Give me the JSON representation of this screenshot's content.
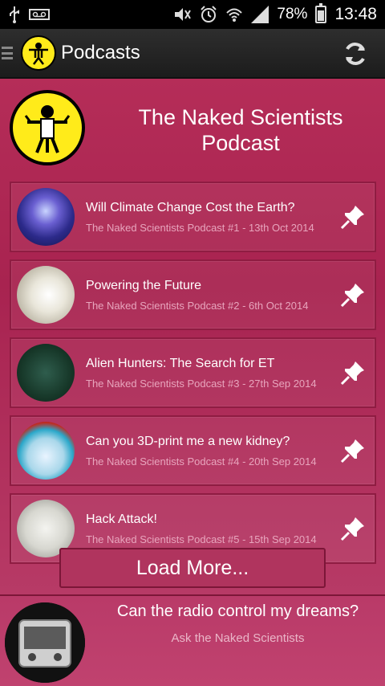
{
  "status_bar": {
    "battery": "78%",
    "time": "13:48"
  },
  "app_bar": {
    "title": "Podcasts"
  },
  "podcast": {
    "title": "The Naked Scientists Podcast"
  },
  "episodes": [
    {
      "title": "Will Climate Change Cost the Earth?",
      "meta": "The Naked Scientists Podcast #1  -  13th Oct 2014"
    },
    {
      "title": "Powering the Future",
      "meta": "The Naked Scientists Podcast #2  -  6th Oct 2014"
    },
    {
      "title": "Alien Hunters: The Search for ET",
      "meta": "The Naked Scientists Podcast #3  -  27th Sep 2014"
    },
    {
      "title": "Can you 3D-print me a new kidney?",
      "meta": "The Naked Scientists Podcast #4  -  20th Sep 2014"
    },
    {
      "title": "Hack Attack!",
      "meta": "The Naked Scientists Podcast #5  -  15th Sep 2014"
    }
  ],
  "load_more_label": "Load More...",
  "promo": {
    "title": "Can the radio control my dreams?",
    "subtitle": "Ask the Naked Scientists"
  },
  "icons": {
    "status_left": [
      "usb-icon",
      "voicemail-icon"
    ],
    "status_right": [
      "mute-icon",
      "alarm-icon",
      "wifi-icon",
      "signal-icon",
      "battery-icon"
    ],
    "app_bar": [
      "hamburger-icon",
      "naked-scientists-logo",
      "refresh-icon"
    ],
    "episode_action": "pin-icon"
  },
  "colors": {
    "background": "#b52d58",
    "app_bar": "#262626",
    "logo_yellow": "#ffeb1a",
    "meta_text": "#e8a5bd"
  }
}
